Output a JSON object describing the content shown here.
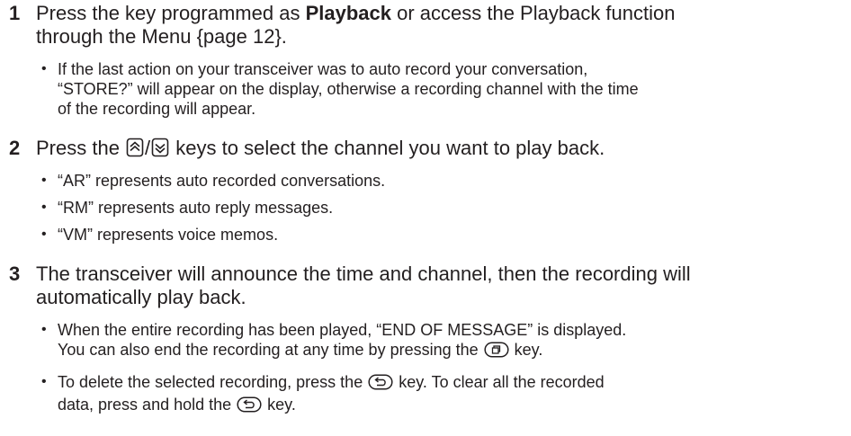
{
  "steps": [
    {
      "number": "1",
      "text_before": "Press the key programmed as ",
      "text_bold": "Playback",
      "text_after_line1": " or access the Playback function",
      "text_line2": "through the Menu {page 12}.",
      "bullets": [
        {
          "line1": "If the last action on your transceiver was to auto record your conversation,",
          "line2": "“STORE?” will appear on the display, otherwise a recording channel with the time",
          "line3": "of the recording will appear."
        }
      ]
    },
    {
      "number": "2",
      "text_before": "Press the ",
      "text_separator": "/",
      "text_after": " keys to select the channel you want to play back.",
      "icons": [
        "up-arrow-key-icon",
        "down-arrow-key-icon"
      ],
      "bullets": [
        {
          "line1": "“AR” represents auto recorded conversations."
        },
        {
          "line1": "“RM” represents auto reply messages."
        },
        {
          "line1": "“VM” represents voice memos."
        }
      ]
    },
    {
      "number": "3",
      "line1": "The transceiver will announce the time and channel, then the recording will",
      "line2": "automatically play back.",
      "bullets": [
        {
          "line1": "When the entire recording has been played, “END OF MESSAGE” is displayed.",
          "line2_before": "You can also end the recording at any time by pressing the ",
          "line2_after": " key.",
          "icon": "menu-key-icon"
        },
        {
          "line1_before": "To delete the selected recording, press the ",
          "line1_after": " key.  To clear all the recorded",
          "line2_before": "data, press and hold the ",
          "line2_after": " key.",
          "icon": "back-key-icon"
        }
      ]
    }
  ]
}
